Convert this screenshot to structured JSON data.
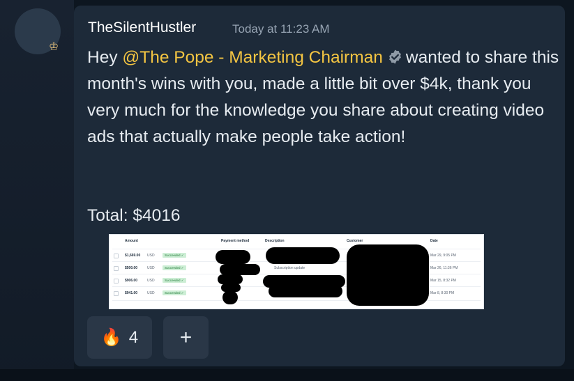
{
  "message": {
    "username": "TheSilentHustler",
    "timestamp": "Today at 11:23 AM",
    "greeting": "Hey ",
    "mention": "@The Pope - Marketing Chairman",
    "body_after_mention": "wanted to share this month's wins with you, made a little bit over $4k, thank you very much for the knowledge you share about creating video ads that actually make people take action!",
    "total": "Total: $4016"
  },
  "payments": {
    "headers": [
      "Amount",
      "Payment method",
      "Description",
      "Customer",
      "Date"
    ],
    "rows": [
      {
        "amount": "$1,669.00",
        "currency": "USD",
        "status": "Succeeded ✓",
        "description": "",
        "date": "Mar 29, 9:05 PM"
      },
      {
        "amount": "$500.00",
        "currency": "USD",
        "status": "Succeeded ✓",
        "description": "Subscription update",
        "date": "Mar 26, 11:36 PM"
      },
      {
        "amount": "$906.00",
        "currency": "USD",
        "status": "Succeeded ✓",
        "description": "",
        "date": "Mar 15, 8:32 PM"
      },
      {
        "amount": "$941.00",
        "currency": "USD",
        "status": "Succeeded ✓",
        "description": "",
        "date": "Mar 8, 8:30 PM"
      }
    ]
  },
  "reactions": [
    {
      "emoji": "🔥",
      "count": "4"
    }
  ],
  "add_reaction_label": "+",
  "colors": {
    "mention": "#f4c542",
    "card_background": "#1d2a39",
    "page_background": "#0d1620"
  },
  "icons": {
    "verified": "verified-check-icon",
    "crown": "crown-icon"
  }
}
